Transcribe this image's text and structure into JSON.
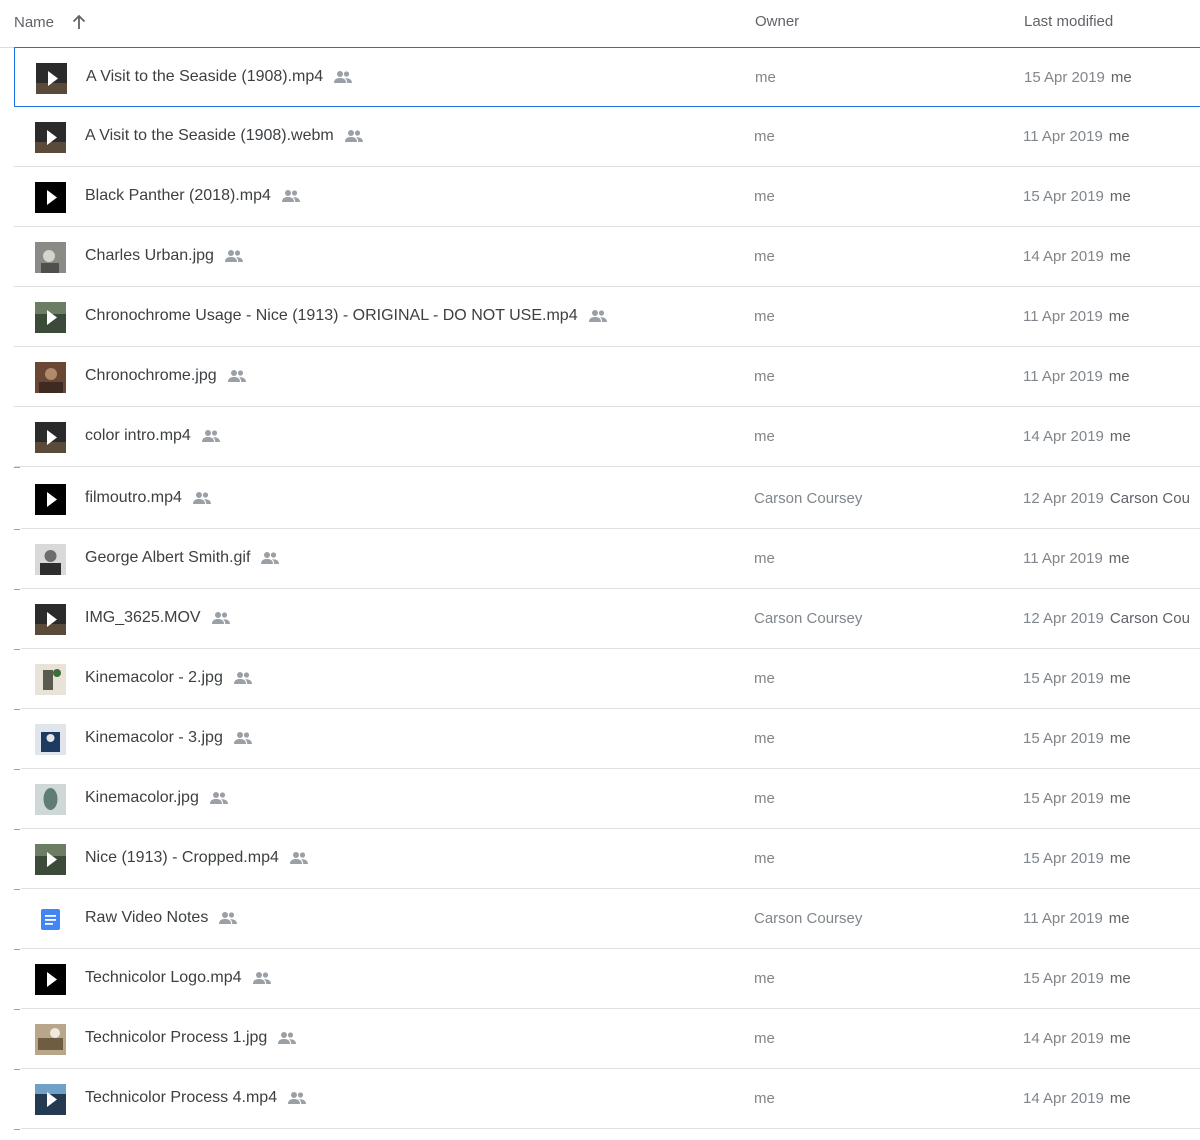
{
  "header": {
    "name_label": "Name",
    "owner_label": "Owner",
    "modified_label": "Last modified",
    "sort_icon": "arrow-up-icon"
  },
  "colors": {
    "selection_border": "#1a73e8",
    "doc_icon": "#4285f4",
    "muted_text": "#80868b"
  },
  "files": [
    {
      "name": "A Visit to the Seaside (1908).mp4",
      "owner": "me",
      "date": "15 Apr 2019",
      "modified_by": "me",
      "thumb": "video-thumb-dark",
      "selected": true
    },
    {
      "name": "A Visit to the Seaside (1908).webm",
      "owner": "me",
      "date": "11 Apr 2019",
      "modified_by": "me",
      "thumb": "video-thumb-dark"
    },
    {
      "name": "Black Panther (2018).mp4",
      "owner": "me",
      "date": "15 Apr 2019",
      "modified_by": "me",
      "thumb": "video-thumb-black"
    },
    {
      "name": "Charles Urban.jpg",
      "owner": "me",
      "date": "14 Apr 2019",
      "modified_by": "me",
      "thumb": "image-thumb-gray"
    },
    {
      "name": "Chronochrome Usage - Nice (1913) - ORIGINAL - DO NOT USE.mp4",
      "owner": "me",
      "date": "11 Apr 2019",
      "modified_by": "me",
      "thumb": "video-thumb-green"
    },
    {
      "name": "Chronochrome.jpg",
      "owner": "me",
      "date": "11 Apr 2019",
      "modified_by": "me",
      "thumb": "image-thumb-brown"
    },
    {
      "name": "color intro.mp4",
      "owner": "me",
      "date": "14 Apr 2019",
      "modified_by": "me",
      "thumb": "video-thumb-dark"
    },
    {
      "name": "filmoutro.mp4",
      "owner": "Carson Coursey",
      "date": "12 Apr 2019",
      "modified_by": "Carson Cou",
      "thumb": "video-thumb-black"
    },
    {
      "name": "George Albert Smith.gif",
      "owner": "me",
      "date": "11 Apr 2019",
      "modified_by": "me",
      "thumb": "image-thumb-portrait"
    },
    {
      "name": "IMG_3625.MOV",
      "owner": "Carson Coursey",
      "date": "12 Apr 2019",
      "modified_by": "Carson Cou",
      "thumb": "video-thumb-dark"
    },
    {
      "name": "Kinemacolor - 2.jpg",
      "owner": "me",
      "date": "15 Apr 2019",
      "modified_by": "me",
      "thumb": "image-thumb-light"
    },
    {
      "name": "Kinemacolor - 3.jpg",
      "owner": "me",
      "date": "15 Apr 2019",
      "modified_by": "me",
      "thumb": "image-thumb-blue"
    },
    {
      "name": "Kinemacolor.jpg",
      "owner": "me",
      "date": "15 Apr 2019",
      "modified_by": "me",
      "thumb": "image-thumb-teal"
    },
    {
      "name": "Nice (1913) - Cropped.mp4",
      "owner": "me",
      "date": "15 Apr 2019",
      "modified_by": "me",
      "thumb": "video-thumb-green"
    },
    {
      "name": "Raw Video Notes",
      "owner": "Carson Coursey",
      "date": "11 Apr 2019",
      "modified_by": "me",
      "thumb": "doc-icon"
    },
    {
      "name": "Technicolor Logo.mp4",
      "owner": "me",
      "date": "15 Apr 2019",
      "modified_by": "me",
      "thumb": "video-thumb-black"
    },
    {
      "name": "Technicolor Process 1.jpg",
      "owner": "me",
      "date": "14 Apr 2019",
      "modified_by": "me",
      "thumb": "image-thumb-tan"
    },
    {
      "name": "Technicolor Process 4.mp4",
      "owner": "me",
      "date": "14 Apr 2019",
      "modified_by": "me",
      "thumb": "video-thumb-blue"
    }
  ]
}
